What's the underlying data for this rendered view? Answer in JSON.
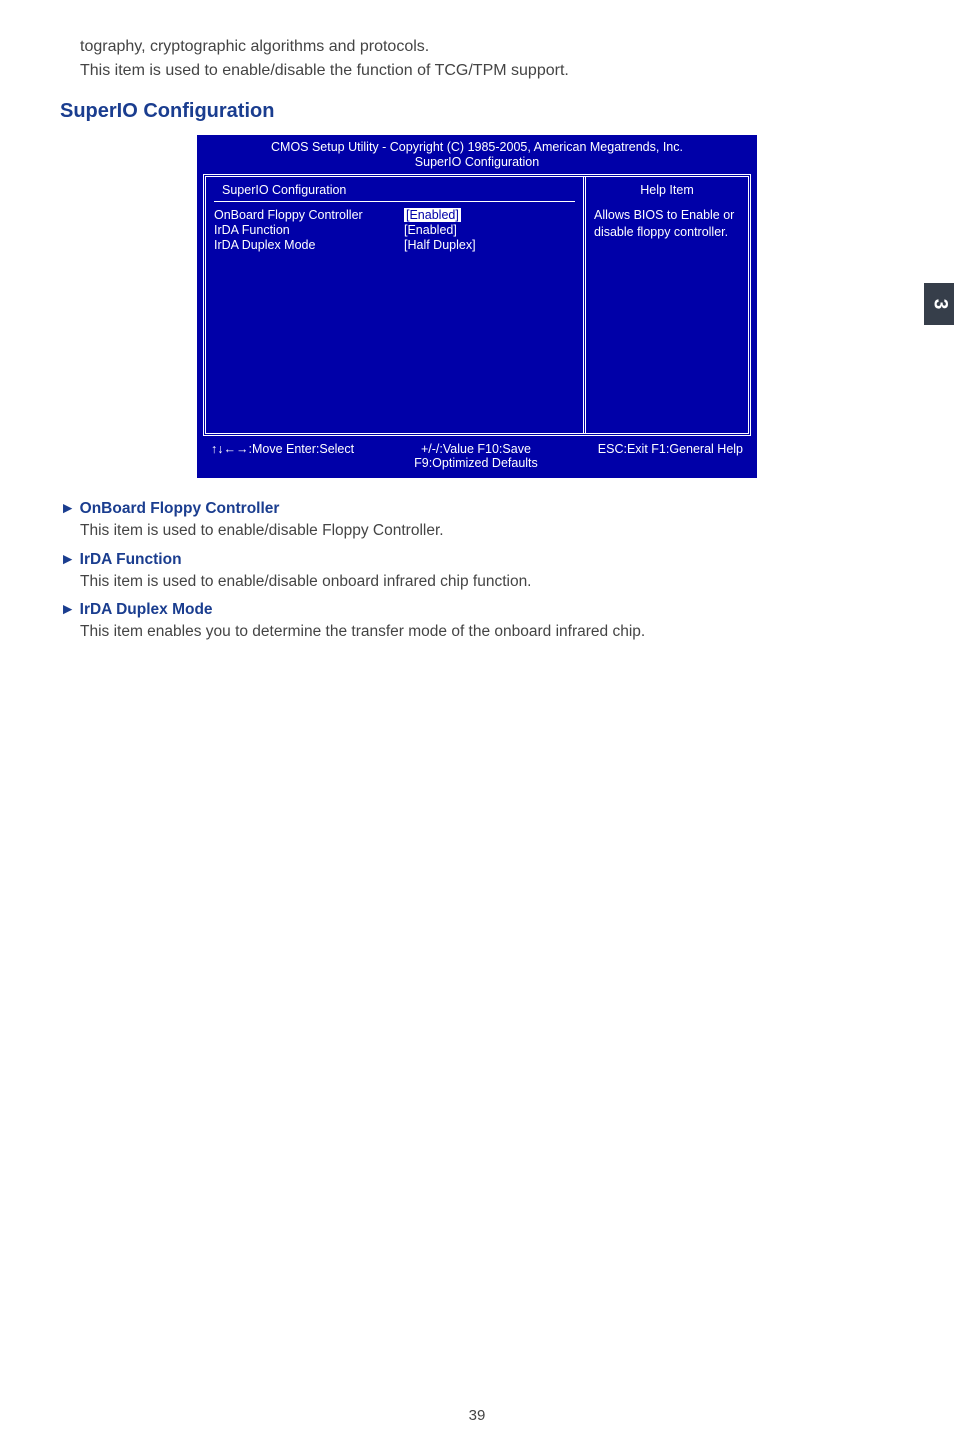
{
  "fragment": {
    "line1": "tography, cryptographic algorithms and protocols.",
    "line2": "This item is used to enable/disable the function of TCG/TPM support."
  },
  "heading": "SuperIO Configuration",
  "bios": {
    "title": "CMOS Setup Utility - Copyright (C) 1985-2005, American Megatrends, Inc.",
    "subtitle": "SuperIO Configuration",
    "left_header": "SuperIO Configuration",
    "rows": [
      {
        "label": "OnBoard Floppy Controller",
        "value": "[Enabled]",
        "highlighted": true
      },
      {
        "label": "IrDA Function",
        "value": "[Enabled]",
        "highlighted": false
      },
      {
        "label": "IrDA Duplex Mode",
        "value": "[Half Duplex]",
        "highlighted": false
      }
    ],
    "right_header": "Help Item",
    "help_text": "Allows BIOS to Enable or disable floppy controller.",
    "footer": {
      "left": "↑↓←→:Move   Enter:Select",
      "center_top": "+/-/:Value     F10:Save",
      "center_bottom": "F9:Optimized Defaults",
      "right": "ESC:Exit    F1:General Help"
    }
  },
  "items": [
    {
      "title": "► OnBoard Floppy Controller",
      "body": "This item is used to enable/disable Floppy Controller."
    },
    {
      "title": "► IrDA Function",
      "body": "This item is used to enable/disable onboard infrared chip function."
    },
    {
      "title": "► IrDA Duplex Mode",
      "body": "This item enables you to determine the transfer mode of the onboard infrared chip."
    }
  ],
  "side_tab": "3",
  "page_number": "39"
}
